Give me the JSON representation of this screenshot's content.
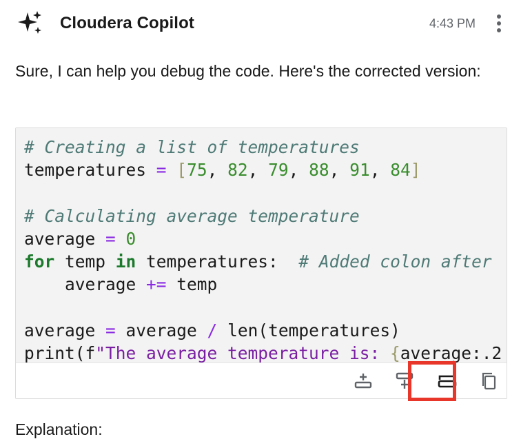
{
  "header": {
    "title": "Cloudera Copilot",
    "time": "4:43 PM",
    "logo_icon": "sparkle-icon",
    "menu_icon": "kebab-menu-icon"
  },
  "message": {
    "intro": "Sure, I can help you debug the code. Here's the corrected version:",
    "explanation_label": "Explanation:"
  },
  "code": {
    "lines": [
      "# Creating a list of temperatures",
      "temperatures = [75, 82, 79, 88, 91, 84]",
      "",
      "# Calculating average temperature",
      "average = 0",
      "for temp in temperatures:  # Added colon after",
      "    average += temp",
      "",
      "average = average / len(temperatures)",
      "print(f\"The average temperature is: {average:.2"
    ]
  },
  "toolbar": {
    "buttons": [
      {
        "name": "insert-above-icon"
      },
      {
        "name": "insert-below-icon"
      },
      {
        "name": "replace-icon"
      },
      {
        "name": "copy-icon"
      }
    ],
    "highlight_color": "#e8372a"
  },
  "colors": {
    "comment": "#4e7a76",
    "number": "#3a8d2e",
    "operator": "#8a2be2",
    "keyword": "#1c7a2c",
    "string": "#7a1fa2",
    "code_background": "#f3f3f3"
  }
}
